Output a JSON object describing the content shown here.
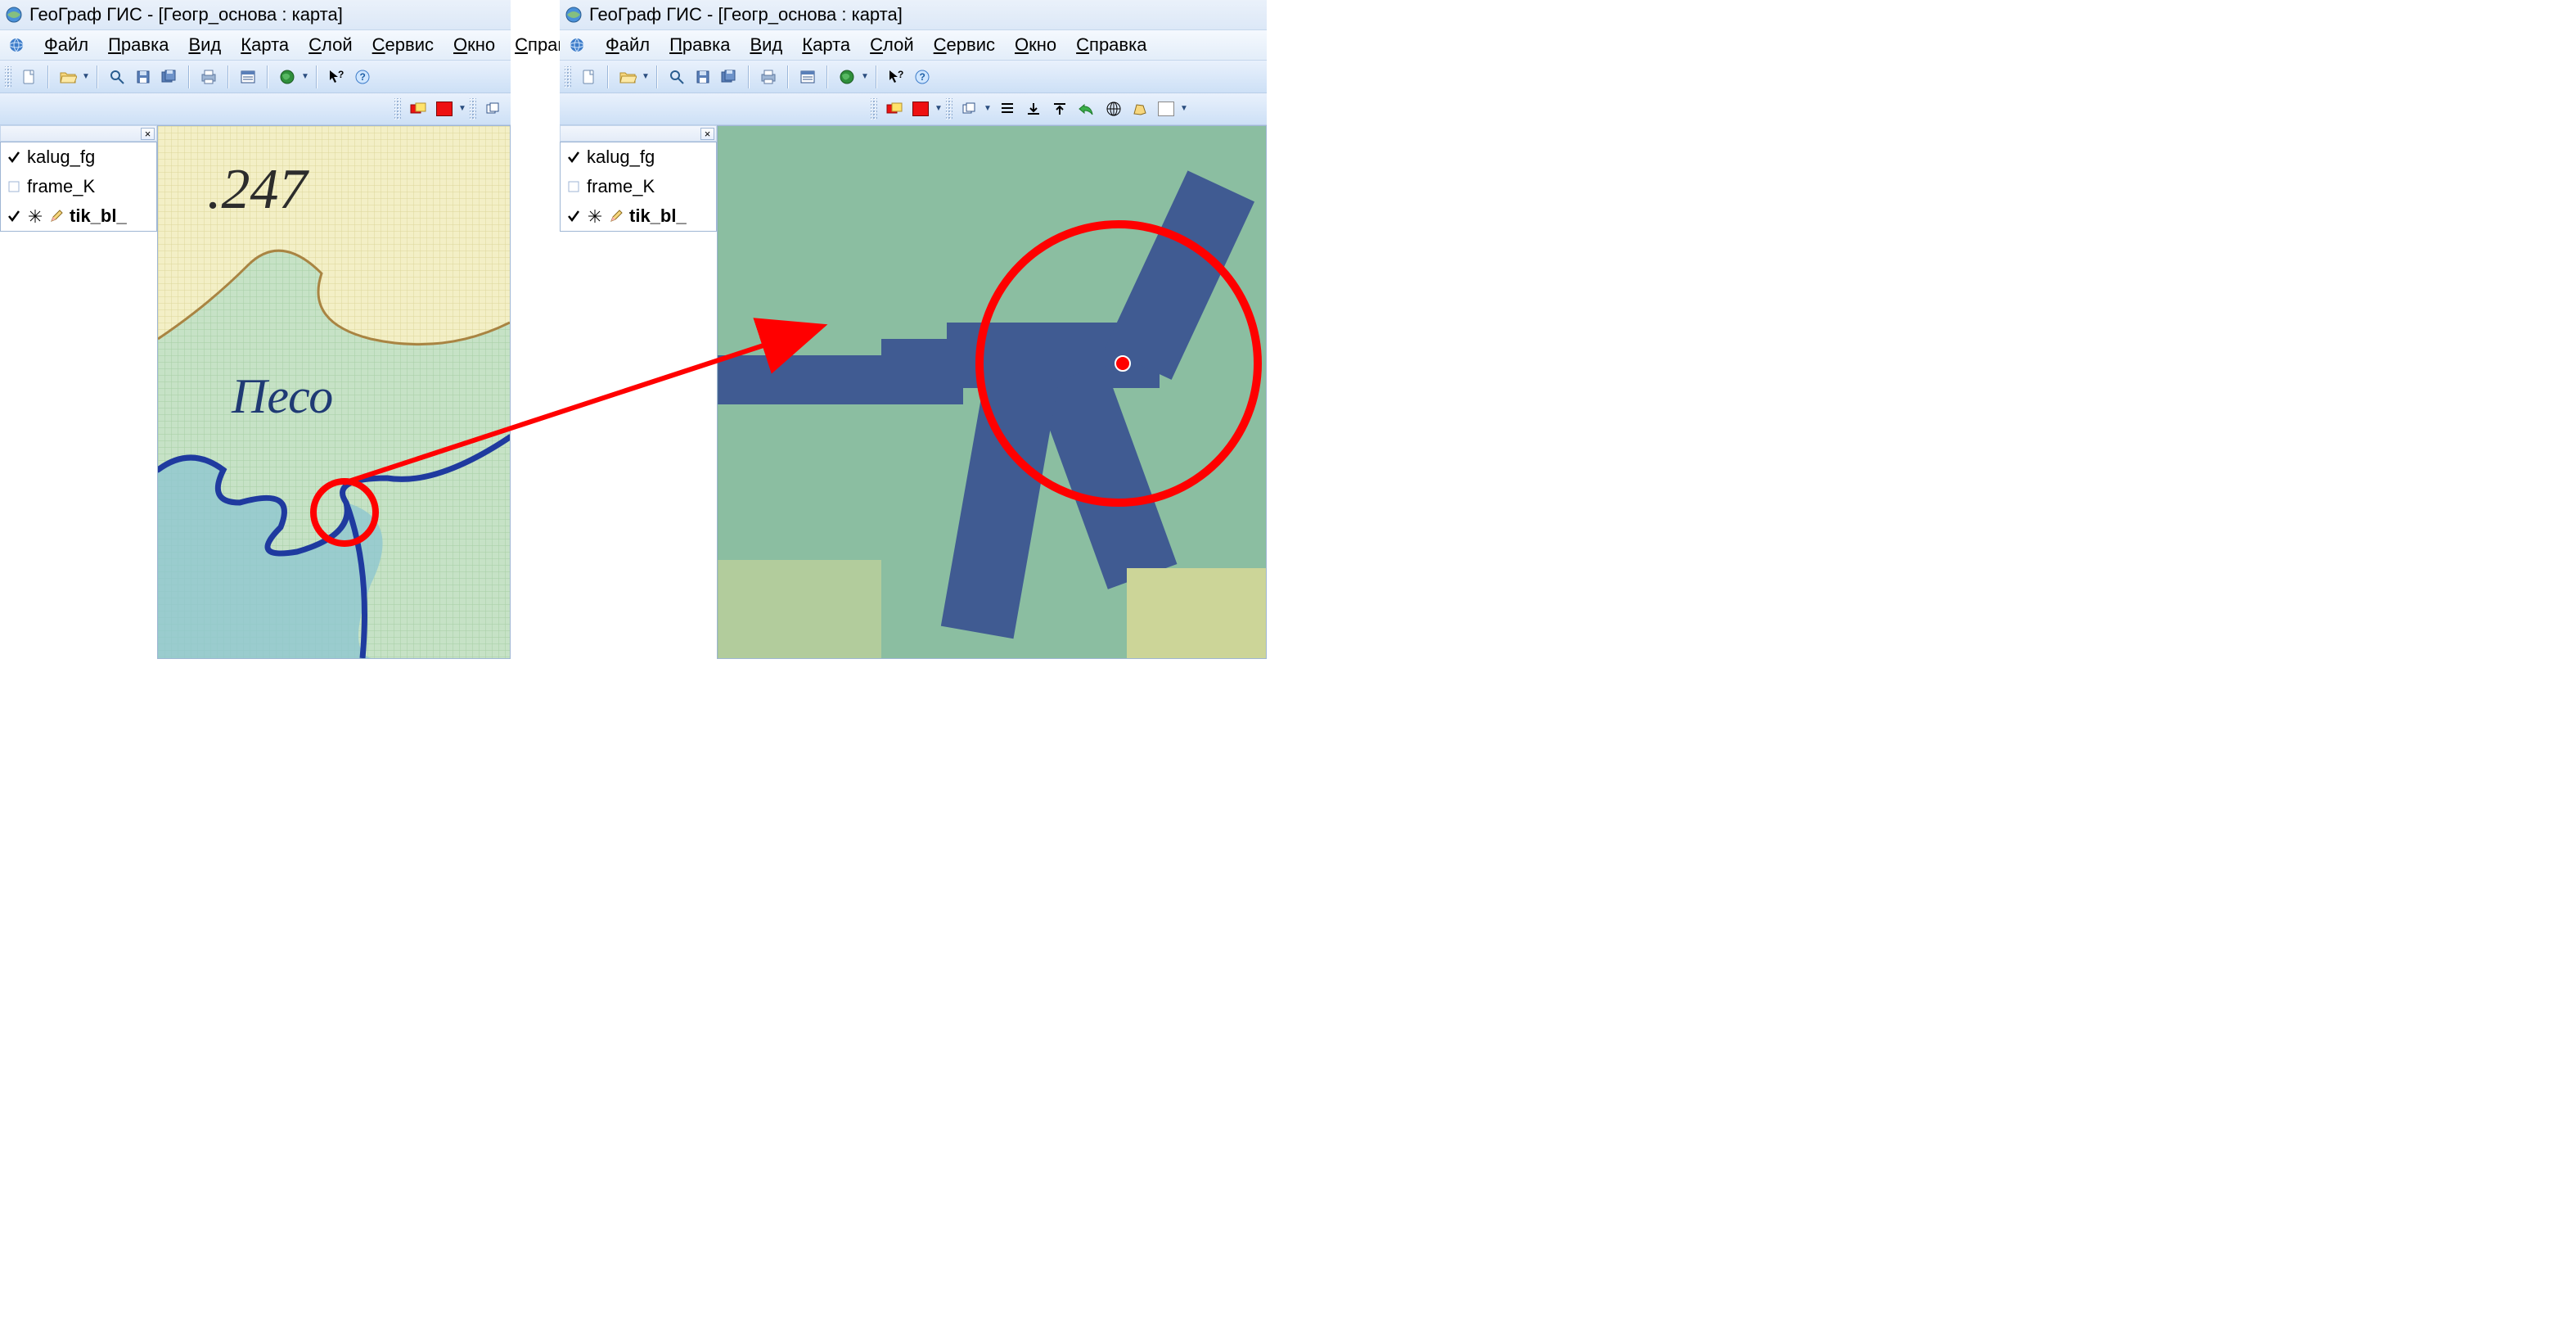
{
  "app": {
    "title": "ГеоГраф ГИС - [Геогр_основа : карта]"
  },
  "menu": {
    "items": [
      {
        "label": "Файл",
        "ul_index": 0
      },
      {
        "label": "Правка",
        "ul_index": 0
      },
      {
        "label": "Вид",
        "ul_index": 0
      },
      {
        "label": "Карта",
        "ul_index": 0
      },
      {
        "label": "Слой",
        "ul_index": 0
      },
      {
        "label": "Сервис",
        "ul_index": 0
      },
      {
        "label": "Окно",
        "ul_index": 0
      },
      {
        "label": "Справка",
        "ul_index": 0
      }
    ]
  },
  "icons": {
    "new": "new-file-icon",
    "open": "open-folder-icon",
    "zoom": "magnifier-icon",
    "save": "save-icon",
    "saveall": "save-all-icon",
    "print": "print-icon",
    "window": "window-icon",
    "globe": "globe-green-icon",
    "helpcursor": "help-cursor-icon",
    "help": "help-icon"
  },
  "layers": {
    "items": [
      {
        "name": "kalug_fg",
        "checked": true,
        "edit": false
      },
      {
        "name": "frame_K",
        "checked": false,
        "edit": false
      },
      {
        "name": "tik_bl_",
        "checked": true,
        "edit": true
      }
    ]
  },
  "map": {
    "elevation_label": ".247",
    "river_label": "Песо"
  }
}
